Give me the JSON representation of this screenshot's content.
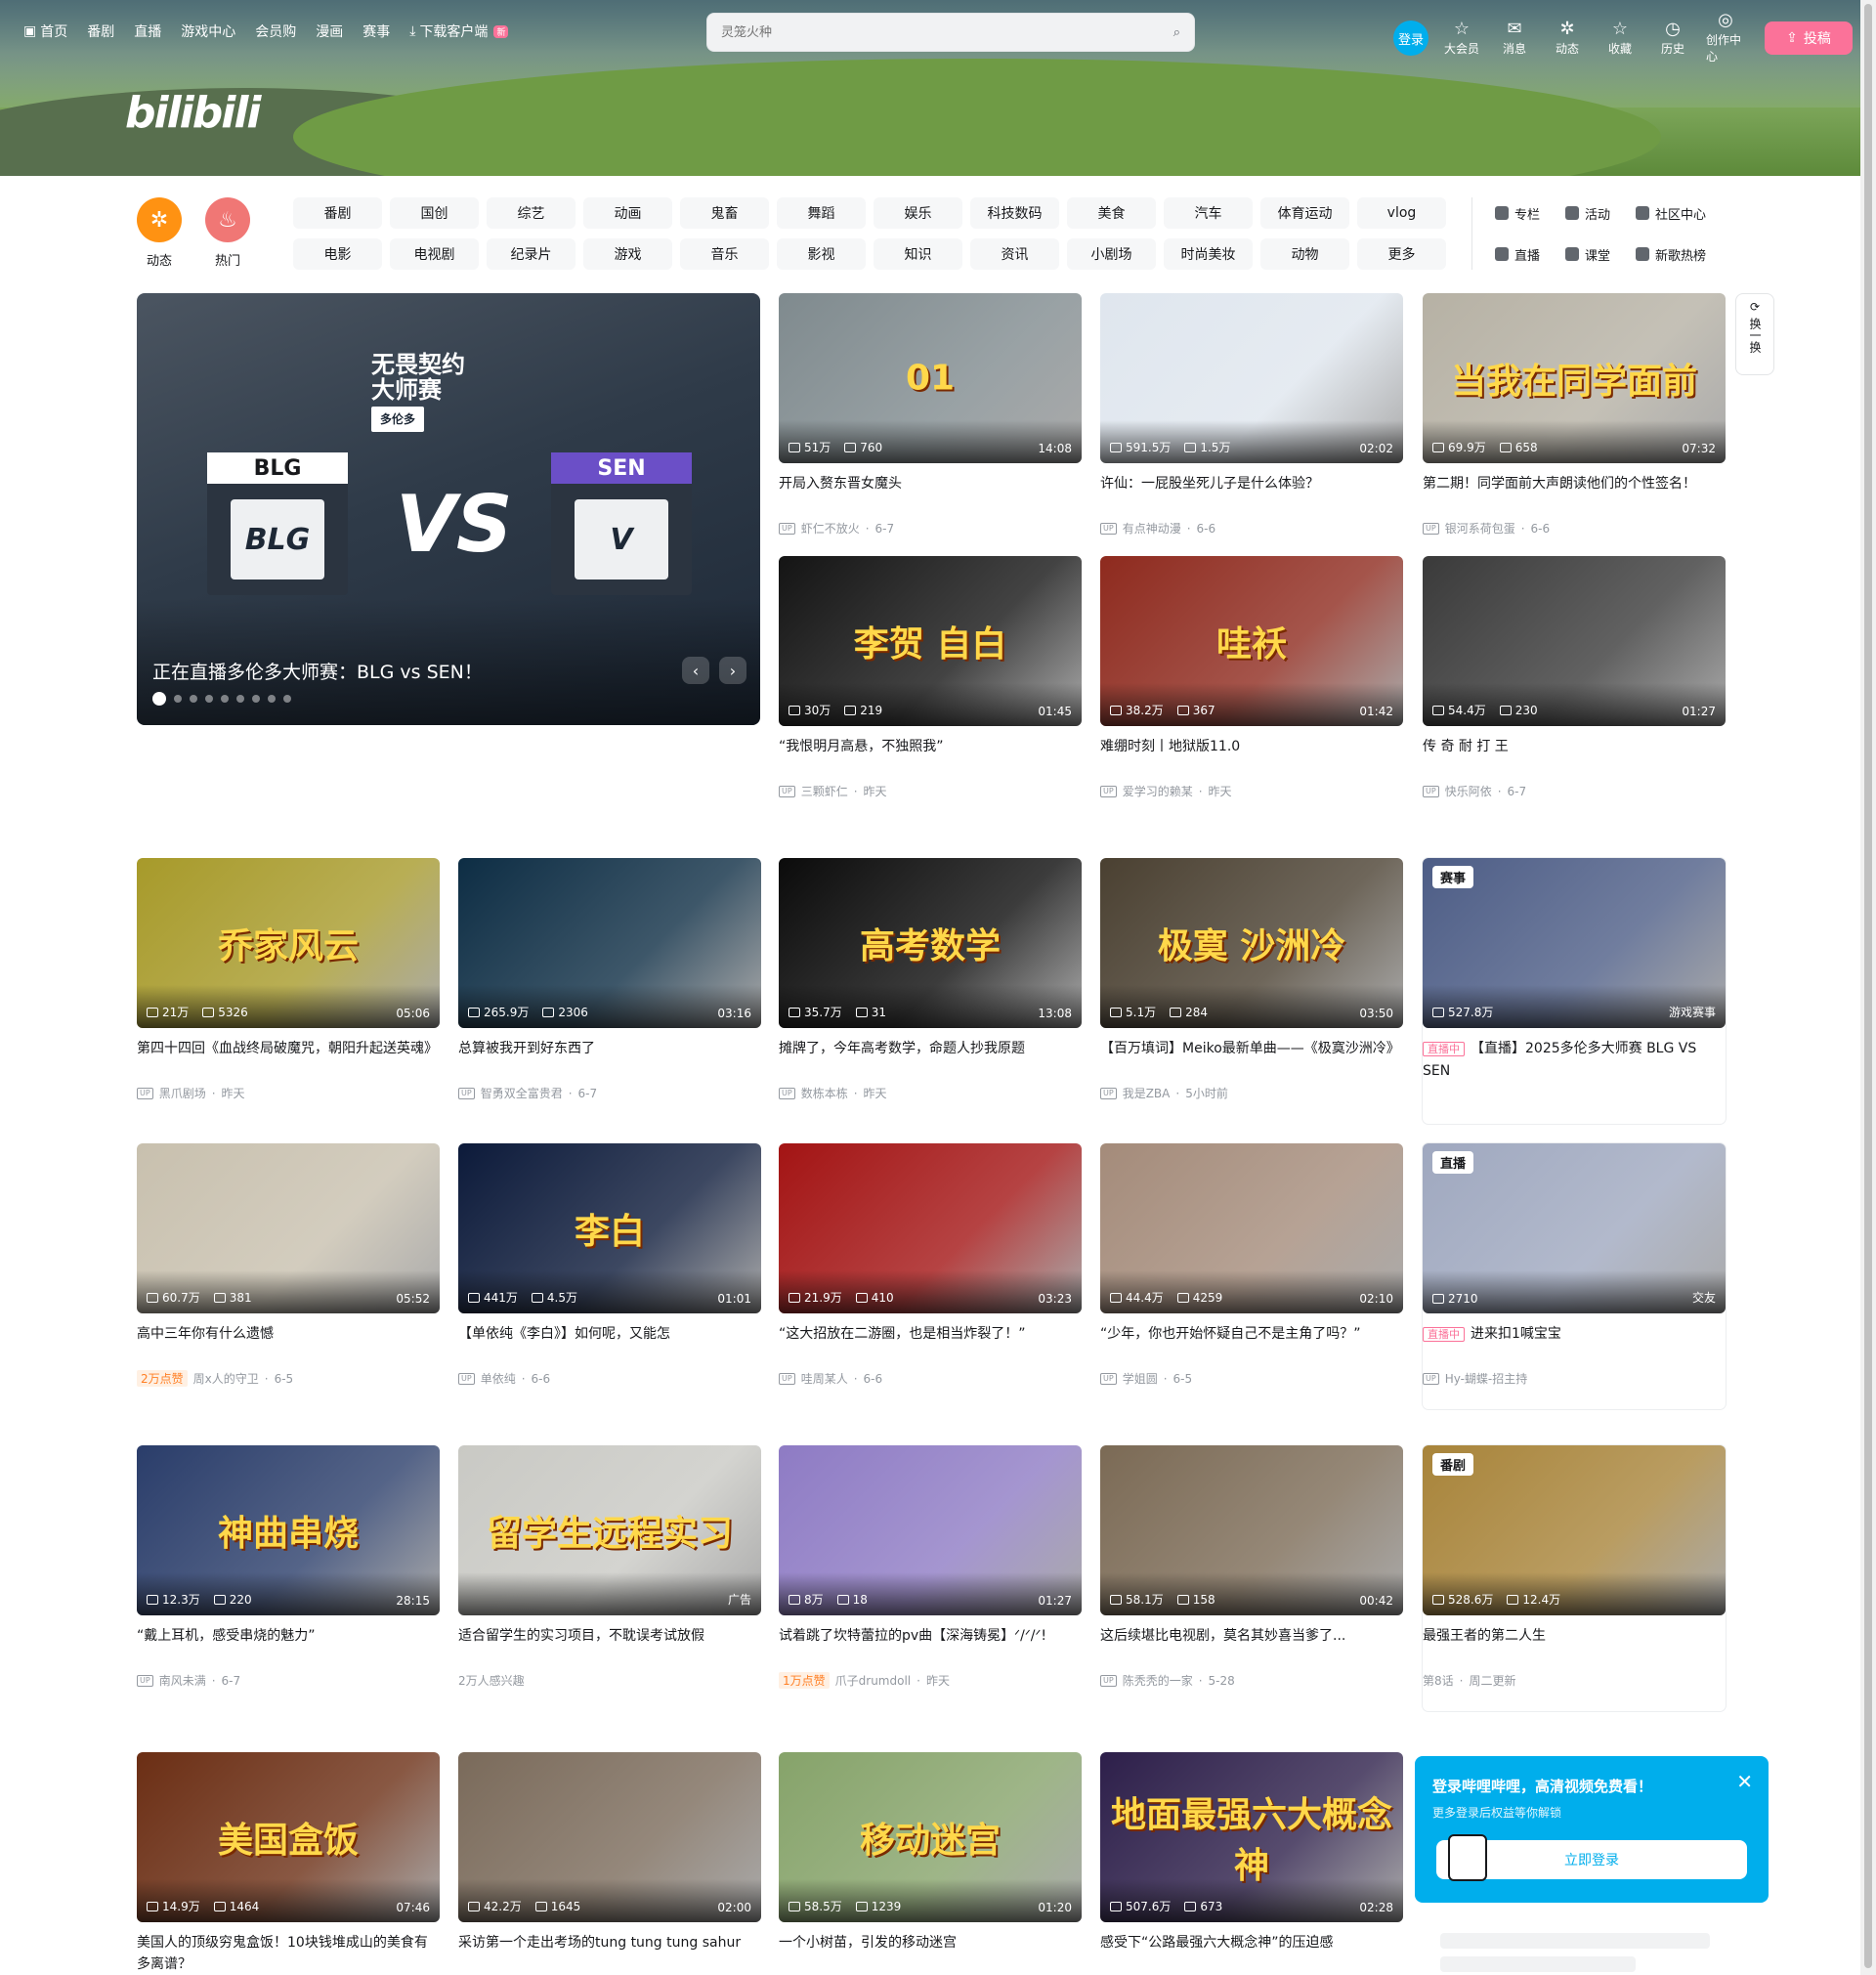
{
  "header": {
    "nav": [
      {
        "label": "首页",
        "icon": "tv-icon"
      },
      {
        "label": "番剧"
      },
      {
        "label": "直播"
      },
      {
        "label": "游戏中心"
      },
      {
        "label": "会员购"
      },
      {
        "label": "漫画"
      },
      {
        "label": "赛事"
      },
      {
        "label": "下载客户端",
        "icon": "download-icon",
        "badge": "新"
      }
    ],
    "search_placeholder": "灵笼火种",
    "login": "登录",
    "right": [
      {
        "label": "大会员",
        "icon": "vip-icon"
      },
      {
        "label": "消息",
        "icon": "mail-icon"
      },
      {
        "label": "动态",
        "icon": "dynamic-icon"
      },
      {
        "label": "收藏",
        "icon": "star-icon"
      },
      {
        "label": "历史",
        "icon": "clock-icon"
      },
      {
        "label": "创作中心",
        "icon": "bulb-icon"
      }
    ],
    "upload": "投稿",
    "logo": "bilibili"
  },
  "channels": {
    "circles": [
      {
        "label": "动态",
        "color": "#ff9212"
      },
      {
        "label": "热门",
        "color": "#f07775"
      }
    ],
    "grid": [
      "番剧",
      "国创",
      "综艺",
      "动画",
      "鬼畜",
      "舞蹈",
      "娱乐",
      "科技数码",
      "美食",
      "汽车",
      "体育运动",
      "vlog",
      "电影",
      "电视剧",
      "纪录片",
      "游戏",
      "音乐",
      "影视",
      "知识",
      "资讯",
      "小剧场",
      "时尚美妆",
      "动物",
      "更多"
    ],
    "extra": [
      "专栏",
      "活动",
      "社区中心",
      "直播",
      "课堂",
      "新歌热榜"
    ]
  },
  "carousel": {
    "title": "正在直播多伦多大师赛：BLG vs SEN！",
    "event_line1": "无畏契约",
    "event_line2": "大师赛",
    "event_city": "多伦多",
    "team_left": "BLG",
    "team_right": "SEN",
    "vs": "VS",
    "slides": 9,
    "active": 0
  },
  "refresh": "换一换",
  "videos": [
    {
      "title": "开局入赘东晋女魔头",
      "views": "51万",
      "danmaku": "760",
      "dur": "14:08",
      "up": "虾仁不放火",
      "date": "6-7",
      "bg": "#7f8a8e",
      "big": "01"
    },
    {
      "title": "许仙：一屁股坐死儿子是什么体验？",
      "views": "591.5万",
      "danmaku": "1.5万",
      "dur": "02:02",
      "up": "有点神动漫",
      "date": "6-6",
      "bg": "#dfe6ee",
      "big": ""
    },
    {
      "title": "第二期！同学面前大声朗读他们的个性签名！",
      "views": "69.9万",
      "danmaku": "658",
      "dur": "07:32",
      "up": "银河系荷包蛋",
      "date": "6-6",
      "bg": "#b6b1a4",
      "big": "当我在同学面前"
    },
    {
      "title": "“我恨明月高悬，不独照我”",
      "views": "30万",
      "danmaku": "219",
      "dur": "01:45",
      "up": "三颗虾仁",
      "date": "昨天",
      "bg": "#141414",
      "big": "李贺 自白"
    },
    {
      "title": "难绷时刻丨地狱版11.0",
      "views": "38.2万",
      "danmaku": "367",
      "dur": "01:42",
      "up": "爱学习的赖某",
      "date": "昨天",
      "bg": "#8e2a1e",
      "big": "哇袄"
    },
    {
      "title": "传 奇 耐 打 王",
      "views": "54.4万",
      "danmaku": "230",
      "dur": "01:27",
      "up": "快乐阿依",
      "date": "6-7",
      "bg": "#3a3a3a",
      "big": ""
    },
    {
      "title": "第四十四回《血战终局破魔咒，朝阳升起送英魂》",
      "views": "21万",
      "danmaku": "5326",
      "dur": "05:06",
      "up": "黑爪剧场",
      "date": "昨天",
      "bg": "#a79a2a",
      "big": "乔家风云"
    },
    {
      "title": "总算被我开到好东西了",
      "views": "265.9万",
      "danmaku": "2306",
      "dur": "03:16",
      "up": "智勇双全富贵君",
      "date": "6-7",
      "bg": "#0d2d44",
      "big": ""
    },
    {
      "title": "摊牌了，今年高考数学，命题人抄我原题",
      "views": "35.7万",
      "danmaku": "31",
      "dur": "13:08",
      "up": "数栋本栋",
      "date": "昨天",
      "bg": "#0b0b0b",
      "big": "高考数学"
    },
    {
      "title": "【百万填词】Meiko最新单曲——《极寞沙洲冷》",
      "views": "5.1万",
      "danmaku": "284",
      "dur": "03:50",
      "up": "我是ZBA",
      "date": "5小时前",
      "bg": "#4a4031",
      "big": "极寞 沙洲冷"
    },
    {
      "title": "【直播】2025多伦多大师赛 BLG VS SEN",
      "views": "527.8万",
      "danmaku": "",
      "dur": "游戏赛事",
      "up": "",
      "date": "",
      "bg": "#4d5d86",
      "big": "",
      "tag": "赛事",
      "live": "直播中"
    },
    {
      "title": "高中三年你有什么遗憾",
      "views": "60.7万",
      "danmaku": "381",
      "dur": "05:52",
      "up": "周x人的守卫",
      "date": "6-5",
      "bg": "#c8c0ae",
      "big": "",
      "likes": "2万点赞"
    },
    {
      "title": "【单依纯《李白》】如何呢，又能怎",
      "views": "441万",
      "danmaku": "4.5万",
      "dur": "01:01",
      "up": "单依纯",
      "date": "6-6",
      "bg": "#0c1a3a",
      "big": "李白"
    },
    {
      "title": "“这大招放在二游圈，也是相当炸裂了！”",
      "views": "21.9万",
      "danmaku": "410",
      "dur": "03:23",
      "up": "哇周某人",
      "date": "6-6",
      "bg": "#a31414",
      "big": ""
    },
    {
      "title": "“少年，你也开始怀疑自己不是主角了吗？”",
      "views": "44.4万",
      "danmaku": "4259",
      "dur": "02:10",
      "up": "学姐圆",
      "date": "6-5",
      "bg": "#a48b7a",
      "big": ""
    },
    {
      "title": "进来扣1喊宝宝",
      "views": "2710",
      "danmaku": "",
      "dur": "交友",
      "up": "Hy-蝴蝶-招主持",
      "date": "",
      "bg": "#9fa8bf",
      "big": "",
      "tag": "直播",
      "live": "直播中"
    },
    {
      "title": "“戴上耳机，感受串烧的魅力”",
      "views": "12.3万",
      "danmaku": "220",
      "dur": "28:15",
      "up": "南风未满",
      "date": "6-7",
      "bg": "#2a3d6a",
      "big": "神曲串烧"
    },
    {
      "title": "适合留学生的实习项目，不耽误考试放假",
      "views": "",
      "danmaku": "",
      "dur": "广告",
      "up": "2万人感兴趣",
      "date": "",
      "bg": "#c9c9c4",
      "big": "留学生远程实习",
      "ad": true
    },
    {
      "title": "试着跳了坎特蕾拉的pv曲【深海铸冕】ᐟ/ᐟ/ᐟ!",
      "views": "8万",
      "danmaku": "18",
      "dur": "01:27",
      "up": "爪子drumdoll",
      "date": "昨天",
      "bg": "#8e7bc4",
      "big": "",
      "likes": "1万点赞"
    },
    {
      "title": "这后续堪比电视剧，莫名其妙喜当爹了...",
      "views": "58.1万",
      "danmaku": "158",
      "dur": "00:42",
      "up": "陈秃秃的一家",
      "date": "5-28",
      "bg": "#7b6a55",
      "big": ""
    },
    {
      "title": "最强王者的第二人生",
      "views": "528.6万",
      "danmaku": "12.4万",
      "dur": "",
      "up": "第8话",
      "date": "周二更新",
      "bg": "#a8843a",
      "big": "",
      "tag": "番剧",
      "bangumi": true
    },
    {
      "title": "美国人的顶级穷鬼盒饭！10块钱堆成山的美食有多离谱？",
      "views": "14.9万",
      "danmaku": "1464",
      "dur": "07:46",
      "up": "",
      "date": "",
      "bg": "#6b2e14",
      "big": "美国盒饭"
    },
    {
      "title": "采访第一个走出考场的tung tung tung sahur",
      "views": "42.2万",
      "danmaku": "1645",
      "dur": "02:00",
      "up": "",
      "date": "",
      "bg": "#7a6a5a",
      "big": ""
    },
    {
      "title": "一个小树苗，引发的移动迷宫",
      "views": "58.5万",
      "danmaku": "1239",
      "dur": "01:20",
      "up": "",
      "date": "",
      "bg": "#86a36a",
      "big": "移动迷宫"
    },
    {
      "title": "感受下“公路最强六大概念神”的压迫感",
      "views": "507.6万",
      "danmaku": "673",
      "dur": "02:28",
      "up": "",
      "date": "",
      "bg": "#2d1f4a",
      "big": "地面最强六大概念神"
    }
  ],
  "login_popup": {
    "title": "登录哔哩哔哩，高清视频免费看！",
    "sub": "更多登录后权益等你解锁",
    "button": "立即登录"
  }
}
